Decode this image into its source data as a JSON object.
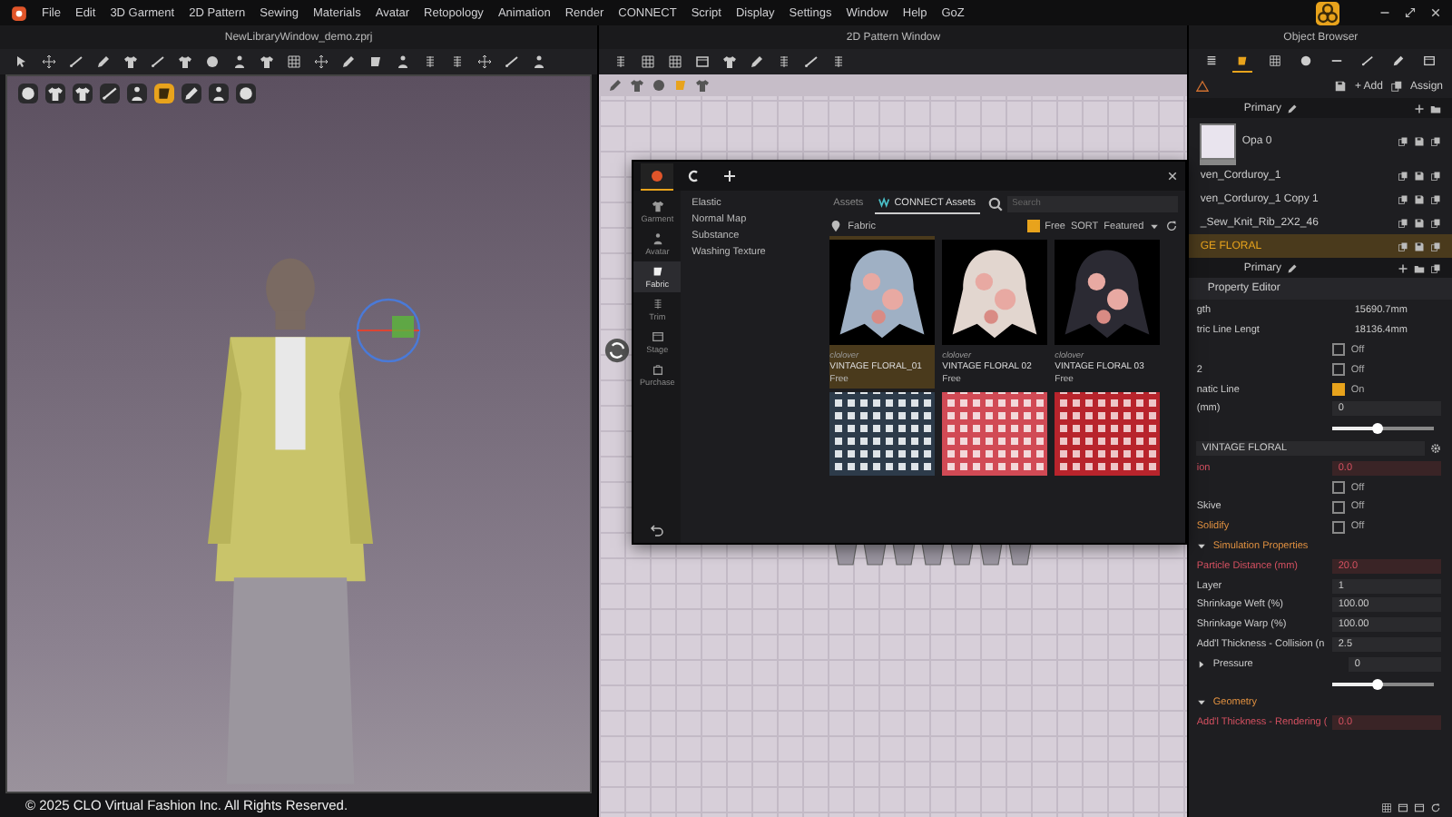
{
  "menu": {
    "items": [
      "File",
      "Edit",
      "3D Garment",
      "2D Pattern",
      "Sewing",
      "Materials",
      "Avatar",
      "Retopology",
      "Animation",
      "Render",
      "CONNECT",
      "Script",
      "Display",
      "Settings",
      "Window",
      "Help",
      "GoZ"
    ]
  },
  "windows": {
    "viewport_3d": {
      "title": "NewLibraryWindow_demo.zprj"
    },
    "pattern_2d": {
      "title": "2D Pattern Window"
    },
    "object_browser": {
      "title": "Object Browser"
    }
  },
  "copyright": "© 2025 CLO Virtual Fashion Inc. All Rights Reserved.",
  "library": {
    "tabs": [
      {
        "kind": "logo",
        "selected": true
      },
      {
        "kind": "connect",
        "selected": false
      },
      {
        "kind": "add",
        "selected": false
      }
    ],
    "rail": [
      {
        "label": "Garment",
        "selected": false
      },
      {
        "label": "Avatar",
        "selected": false
      },
      {
        "label": "Fabric",
        "selected": true
      },
      {
        "label": "Trim",
        "selected": false
      },
      {
        "label": "Stage",
        "selected": false
      },
      {
        "label": "Purchase",
        "selected": false
      }
    ],
    "categories": [
      "Elastic",
      "Normal Map",
      "Substance",
      "Washing Texture"
    ],
    "source_tabs": [
      {
        "label": "Assets",
        "selected": false
      },
      {
        "label": "CONNECT Assets",
        "selected": true
      }
    ],
    "search": {
      "placeholder": "Search"
    },
    "breadcrumb": "Fabric",
    "filter": {
      "free_label": "Free",
      "free_checked": true,
      "sort": "SORT",
      "sort_value": "Featured"
    },
    "assets": [
      {
        "author": "clolover",
        "name": "VINTAGE FLORAL_01",
        "price": "Free",
        "selected": true
      },
      {
        "author": "clolover",
        "name": "VINTAGE FLORAL 02",
        "price": "Free",
        "selected": false
      },
      {
        "author": "clolover",
        "name": "VINTAGE FLORAL 03",
        "price": "Free",
        "selected": false
      }
    ]
  },
  "object_browser": {
    "tabs": [
      {
        "selected": false
      },
      {
        "selected": true
      },
      {
        "selected": false
      },
      {
        "selected": false
      },
      {
        "selected": false
      },
      {
        "selected": false
      },
      {
        "selected": false
      },
      {
        "selected": false
      }
    ],
    "add": "+ Add",
    "assign": "Assign",
    "header": "Primary",
    "fabrics": [
      {
        "kind": "swatch",
        "name": "Opa 0",
        "selected": false
      },
      {
        "kind": "plain",
        "name": "ven_Corduroy_1",
        "selected": false
      },
      {
        "kind": "plain",
        "name": "ven_Corduroy_1 Copy 1",
        "selected": false
      },
      {
        "kind": "plain",
        "name": "_Sew_Knit_Rib_2X2_46",
        "selected": false
      },
      {
        "kind": "plain",
        "name": "GE FLORAL",
        "selected": true
      }
    ],
    "footer_header": "Primary"
  },
  "property_editor": {
    "title": "Property Editor",
    "rows": [
      {
        "kind": "value",
        "label": "gth",
        "value": "15690.7mm"
      },
      {
        "kind": "value",
        "label": "tric Line Lengt",
        "value": "18136.4mm"
      },
      {
        "kind": "checkbox",
        "text": "Off",
        "checked": false
      },
      {
        "kind": "checkbox",
        "label": "2",
        "text": "Off",
        "checked": false,
        "modified": false,
        "heading": false
      },
      {
        "kind": "checkbox",
        "label": "natic Line",
        "text": "On",
        "checked": true,
        "modified": false,
        "heading": false
      },
      {
        "kind": "field",
        "label": "(mm)",
        "value": "0",
        "modified": false
      },
      {
        "kind": "slider",
        "level": 0.45
      },
      {
        "kind": "dropdown",
        "value": "VINTAGE FLORAL"
      },
      {
        "kind": "field",
        "label": "ion",
        "value": "0.0",
        "modified": true
      },
      {
        "kind": "checkbox",
        "text": "Off",
        "checked": false
      },
      {
        "kind": "checkbox",
        "label": "Skive",
        "text": "Off",
        "checked": false,
        "modified": false,
        "heading": false
      },
      {
        "kind": "checkbox",
        "label": "Solidify",
        "text": "Off",
        "checked": false,
        "modified": false,
        "heading": true
      },
      {
        "kind": "section",
        "label": "Simulation Properties",
        "expanded": true
      },
      {
        "kind": "field",
        "label": "Particle Distance (mm)",
        "value": "20.0",
        "modified": true
      },
      {
        "kind": "field",
        "label": "Layer",
        "value": "1",
        "modified": false
      },
      {
        "kind": "field",
        "label": "Shrinkage Weft (%)",
        "value": "100.00",
        "modified": false
      },
      {
        "kind": "field",
        "label": "Shrinkage Warp (%)",
        "value": "100.00",
        "modified": false
      },
      {
        "kind": "field",
        "label": "Add'l Thickness - Collision (n",
        "value": "2.5",
        "modified": false
      },
      {
        "kind": "field",
        "label": "Pressure",
        "value": "0",
        "modified": false,
        "expanded": false
      },
      {
        "kind": "slider",
        "level": 0.45
      },
      {
        "kind": "section",
        "label": "Geometry",
        "expanded": true
      },
      {
        "kind": "field",
        "label": "Add'l Thickness - Rendering (",
        "value": "0.0",
        "modified": true
      }
    ]
  }
}
